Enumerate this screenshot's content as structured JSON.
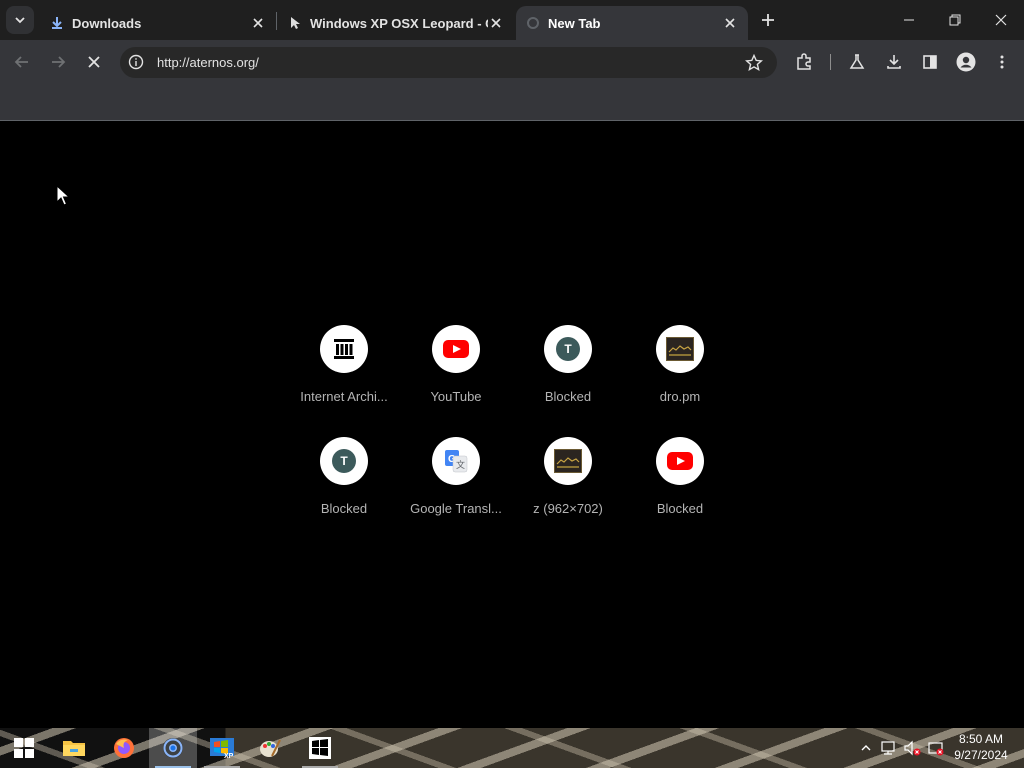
{
  "tabs": [
    {
      "title": "Downloads",
      "icon": "download-icon"
    },
    {
      "title": "Windows XP OSX Leopard - Cr",
      "icon": "cursor-icon"
    },
    {
      "title": "New Tab",
      "icon": "loading-icon"
    }
  ],
  "omnibox": {
    "url": "http://aternos.org/"
  },
  "shortcuts": [
    {
      "label": "Internet Archi...",
      "icon": "archive-icon"
    },
    {
      "label": "YouTube",
      "icon": "youtube-icon"
    },
    {
      "label": "Blocked",
      "icon": "letter-icon",
      "letter": "T"
    },
    {
      "label": "dro.pm",
      "icon": "thumbnail-icon"
    },
    {
      "label": "Blocked",
      "icon": "letter-icon",
      "letter": "T"
    },
    {
      "label": "Google Transl...",
      "icon": "google-translate-icon"
    },
    {
      "label": "z (962×702)",
      "icon": "thumbnail-icon"
    },
    {
      "label": "Blocked",
      "icon": "youtube-icon"
    }
  ],
  "taskbar": {
    "items": [
      "start-icon",
      "file-explorer-icon",
      "firefox-icon",
      "chrome-icon",
      "windows-xp-app-icon",
      "paint-icon",
      "windows-app-icon"
    ],
    "time": "8:50 AM",
    "date": "9/27/2024"
  }
}
